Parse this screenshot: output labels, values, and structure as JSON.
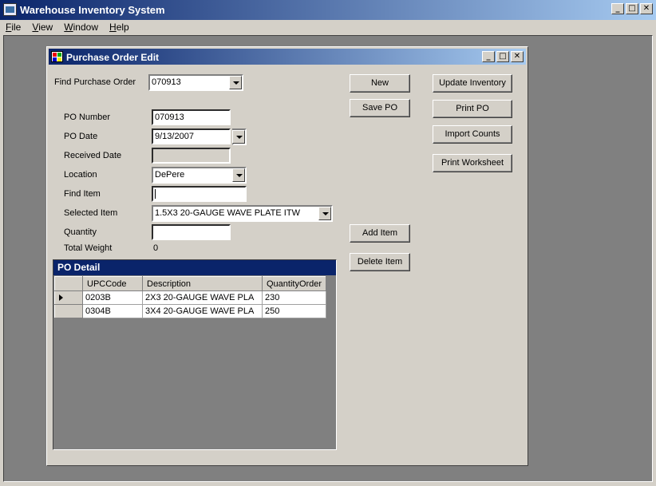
{
  "app": {
    "title": "Warehouse Inventory System"
  },
  "menu": [
    {
      "key": "F",
      "rest": "ile"
    },
    {
      "key": "V",
      "rest": "iew"
    },
    {
      "key": "W",
      "rest": "indow"
    },
    {
      "key": "H",
      "rest": "elp"
    }
  ],
  "window_buttons": {
    "minimize": "_",
    "maximize": "□",
    "close": "✕"
  },
  "form": {
    "title": "Purchase Order Edit",
    "find_po_label": "Find Purchase Order",
    "find_po_value": "070913",
    "po_number_label": "PO Number",
    "po_number_value": "070913",
    "po_date_label": "PO Date",
    "po_date_value": "9/13/2007",
    "received_date_label": "Received Date",
    "received_date_value": "",
    "location_label": "Location",
    "location_value": "DePere",
    "find_item_label": "Find Item",
    "find_item_value": "",
    "selected_item_label": "Selected Item",
    "selected_item_value": "1.5X3 20-GAUGE WAVE PLATE ITW",
    "quantity_label": "Quantity",
    "quantity_value": "",
    "total_weight_label": "Total Weight",
    "total_weight_value": "0"
  },
  "buttons": {
    "new": "New",
    "save_po": "Save PO",
    "add_item": "Add Item",
    "delete_item": "Delete Item",
    "update_inventory": "Update Inventory",
    "print_po": "Print PO",
    "import_counts": "Import Counts",
    "print_worksheet": "Print Worksheet"
  },
  "po_detail": {
    "caption": "PO Detail",
    "columns": [
      "UPCCode",
      "Description",
      "QuantityOrder"
    ],
    "rows": [
      [
        "0203B",
        "2X3 20-GAUGE WAVE PLA",
        "230"
      ],
      [
        "0304B",
        "3X4 20-GAUGE WAVE PLA",
        "250"
      ]
    ]
  }
}
